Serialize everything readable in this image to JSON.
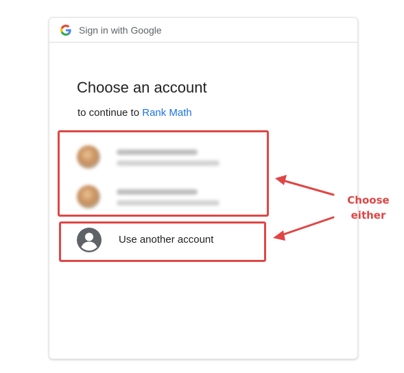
{
  "header": {
    "text": "Sign in with Google",
    "logo_icon": "google-g-icon"
  },
  "main": {
    "title": "Choose an account",
    "subtitle_prefix": "to continue to ",
    "app_link": "Rank Math"
  },
  "accounts": [
    {
      "avatar_icon": "avatar",
      "blurred": true
    },
    {
      "avatar_icon": "avatar",
      "blurred": true
    }
  ],
  "use_another": {
    "label": "Use another account",
    "icon": "person-circle-icon"
  },
  "annotation": {
    "line1": "Choose",
    "line2": "either",
    "color": "#e04545"
  },
  "colors": {
    "link": "#1a73e8",
    "text": "#202124",
    "muted": "#5f6368",
    "annotation": "#e04545"
  }
}
